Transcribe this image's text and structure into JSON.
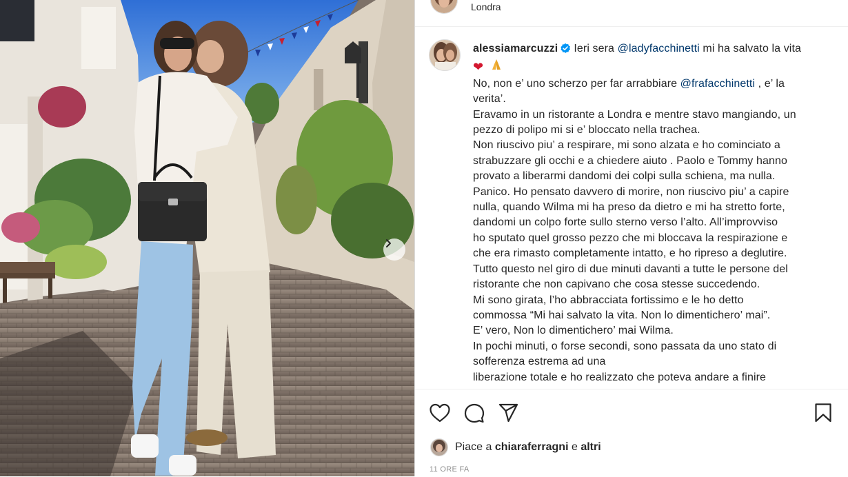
{
  "post": {
    "location": "Londra",
    "username": "alessiamarcuzzi",
    "verified": true,
    "caption_lines": [
      {
        "pre": "Ieri sera ",
        "mention": "@ladyfacchinetti",
        "post": " mi ha salvato la vita"
      },
      {
        "text": "No, non e’ uno scherzo per far arrabbiare ",
        "mention": "@frafacchinetti",
        "post": " , e’ la"
      },
      {
        "text": "verita’."
      },
      {
        "text": "Eravamo in un ristorante a Londra e mentre stavo mangiando, un"
      },
      {
        "text": "pezzo di polipo mi si e’ bloccato nella trachea."
      },
      {
        "text": "Non riuscivo piu’ a respirare, mi sono alzata e ho cominciato a"
      },
      {
        "text": "strabuzzare gli occhi e a chiedere aiuto . Paolo e Tommy hanno"
      },
      {
        "text": "provato a liberarmi dandomi dei colpi sulla schiena, ma nulla."
      },
      {
        "text": "Panico. Ho pensato davvero di morire, non riuscivo piu’ a capire"
      },
      {
        "text": "nulla, quando Wilma mi ha preso da dietro e mi ha stretto forte,"
      },
      {
        "text": "dandomi un colpo forte sullo sterno verso l’alto. All’improvviso"
      },
      {
        "text": "ho sputato quel grosso pezzo che mi bloccava la respirazione e"
      },
      {
        "text": "che era rimasto completamente intatto, e ho ripreso a deglutire."
      },
      {
        "text": "Tutto questo nel giro di due minuti davanti a tutte le persone del"
      },
      {
        "text": "ristorante che non capivano che cosa stesse succedendo."
      },
      {
        "text": "Mi sono girata, l’ho abbracciata fortissimo e le ho detto"
      },
      {
        "text": "commossa “Mi hai salvato la vita. Non lo dimentichero’ mai”."
      },
      {
        "text": "E’ vero, Non lo dimentichero’ mai Wilma."
      },
      {
        "text": "In pochi minuti, o forse secondi, sono passata da uno stato di"
      },
      {
        "text": "sofferenza estrema ad una"
      },
      {
        "text": "liberazione totale e ho realizzato che poteva andare a finire"
      }
    ],
    "emojis": [
      "heart-emoji",
      "pray-emoji"
    ],
    "likes": {
      "prefix": "Piace a ",
      "user": "chiaraferragni",
      "joiner": " e ",
      "others": "altri"
    },
    "timestamp": "11 ORE FA"
  },
  "icons": {
    "like": "heart-outline-icon",
    "comment": "comment-bubble-icon",
    "share": "paper-plane-icon",
    "save": "bookmark-icon",
    "next": "chevron-right-icon",
    "verified": "verified-badge-icon"
  },
  "colors": {
    "mention": "#00376b",
    "verified": "#0095f6",
    "text": "#262626",
    "muted": "#8e8e8e"
  }
}
